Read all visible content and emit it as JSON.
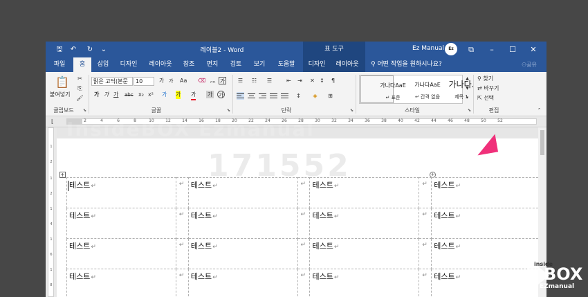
{
  "window": {
    "title": "레이블2 - Word",
    "context_tool": "표 도구",
    "user": "Ez Manual",
    "avatar": "Ez",
    "quick_access": {
      "save": "🖫",
      "undo": "↶",
      "redo": "↻",
      "customize": "⌄"
    }
  },
  "tabs": {
    "file": "파일",
    "home": "홈",
    "insert": "삽입",
    "design": "디자인",
    "layout": "레이아웃",
    "references": "참조",
    "mailings": "편지",
    "review": "검토",
    "view": "보기",
    "help": "도움말",
    "table_design": "디자인",
    "table_layout": "레이아웃",
    "tell_me": "어떤 작업을 원하시나요?",
    "share": "공유",
    "active": "home"
  },
  "ribbon": {
    "clipboard": {
      "paste": "붙여넣기",
      "label": "클립보드"
    },
    "font": {
      "name": "맑은 고딕(본문",
      "size": "10",
      "case": "Aa",
      "grow": "가",
      "shrink": "가",
      "bold": "가",
      "italic": "가",
      "underline": "가",
      "strike": "abc",
      "subscript": "x₂",
      "superscript": "x²",
      "effects": "가",
      "highlight": "가",
      "color": "가",
      "label": "글꼴"
    },
    "paragraph": {
      "label": "단락"
    },
    "styles": {
      "items": [
        {
          "preview": "가나다AaE",
          "name": "↵ 표준"
        },
        {
          "preview": "가나다AaE",
          "name": "↵ 간격 없음"
        },
        {
          "preview": "가나다.",
          "name": "제목 1"
        }
      ],
      "label": "스타일"
    },
    "editing": {
      "find": "찾기",
      "replace": "바꾸기",
      "select": "선택",
      "label": "편집"
    }
  },
  "ruler": {
    "numbers": [
      "2",
      "4",
      "6",
      "8",
      "10",
      "12",
      "14",
      "16",
      "18",
      "20",
      "22",
      "24",
      "26",
      "28",
      "30",
      "32",
      "34",
      "36",
      "38",
      "40",
      "42",
      "44",
      "46",
      "48",
      "50",
      "52"
    ],
    "vertical": [
      "1",
      "2",
      "1",
      "2",
      "1",
      "4",
      "1",
      "6",
      "1",
      "8"
    ]
  },
  "table": {
    "cell_text": "테스트",
    "para_mark": "↵",
    "rows": [
      [
        "테스트",
        "테스트",
        "테스트",
        "테스트"
      ],
      [
        "테스트",
        "테스트",
        "테스트",
        "테스트"
      ],
      [
        "테스트",
        "테스트",
        "테스트",
        "테스트"
      ],
      [
        "테스트",
        "테스트",
        "테스트",
        "테스트"
      ]
    ]
  },
  "overlay": {
    "watermark_brand": "InsideBOX Ezmanual",
    "watermark_id": "171552",
    "logo_small": "inside",
    "logo_big": "BOX",
    "logo_sub": "EZmanual"
  },
  "colors": {
    "titlebar": "#2b579a",
    "context_tab": "#1f467f",
    "arrow": "#f0307a"
  }
}
